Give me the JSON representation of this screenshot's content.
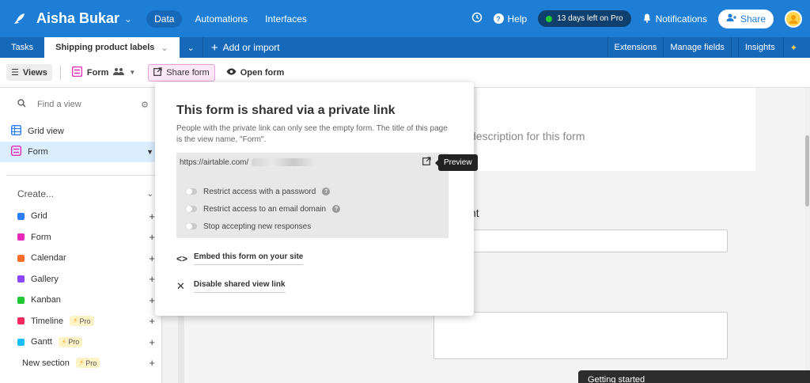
{
  "topbar": {
    "base_name": "Aisha Bukar",
    "nav": [
      "Data",
      "Automations",
      "Interfaces"
    ],
    "help": "Help",
    "trial": "13 days left on Pro",
    "notifications": "Notifications",
    "share": "Share"
  },
  "tabbar": {
    "tabs": [
      "Tasks",
      "Shipping product labels"
    ],
    "add_import": "Add or import",
    "right": [
      "Extensions",
      "Manage fields",
      "Insights"
    ]
  },
  "viewbar": {
    "views": "Views",
    "form": "Form",
    "share_form": "Share form",
    "open_form": "Open form"
  },
  "sidebar": {
    "find_placeholder": "Find a view",
    "views": [
      {
        "label": "Grid view",
        "color": "#2d7ff9"
      },
      {
        "label": "Form",
        "color": "#e929ba"
      }
    ],
    "create_label": "Create...",
    "create_items": [
      {
        "label": "Grid",
        "color": "#2d7ff9",
        "pro": ""
      },
      {
        "label": "Form",
        "color": "#e929ba",
        "pro": ""
      },
      {
        "label": "Calendar",
        "color": "#ff6f2c",
        "pro": ""
      },
      {
        "label": "Gallery",
        "color": "#8b46ff",
        "pro": ""
      },
      {
        "label": "Kanban",
        "color": "#20c933",
        "pro": ""
      },
      {
        "label": "Timeline",
        "color": "#f82b60",
        "pro": "Pro"
      },
      {
        "label": "Gantt",
        "color": "#18bfff",
        "pro": "Pro"
      },
      {
        "label": "New section",
        "color": "",
        "pro": "Pro"
      }
    ]
  },
  "canvas": {
    "description_placeholder": "description for this form",
    "field_label_fragment": "nt"
  },
  "popover": {
    "title": "This form is shared via a private link",
    "description": "People with the private link can only see the empty form. The title of this page is the view name, \"Form\".",
    "link_text": "https://airtable.com/",
    "options": [
      {
        "label": "Restrict access with a password",
        "help": true
      },
      {
        "label": "Restrict access to an email domain",
        "help": true
      },
      {
        "label": "Stop accepting new responses",
        "help": false
      }
    ],
    "embed": "Embed this form on your site",
    "disable": "Disable shared view link"
  },
  "tooltip": "Preview",
  "getting_started": "Getting started"
}
